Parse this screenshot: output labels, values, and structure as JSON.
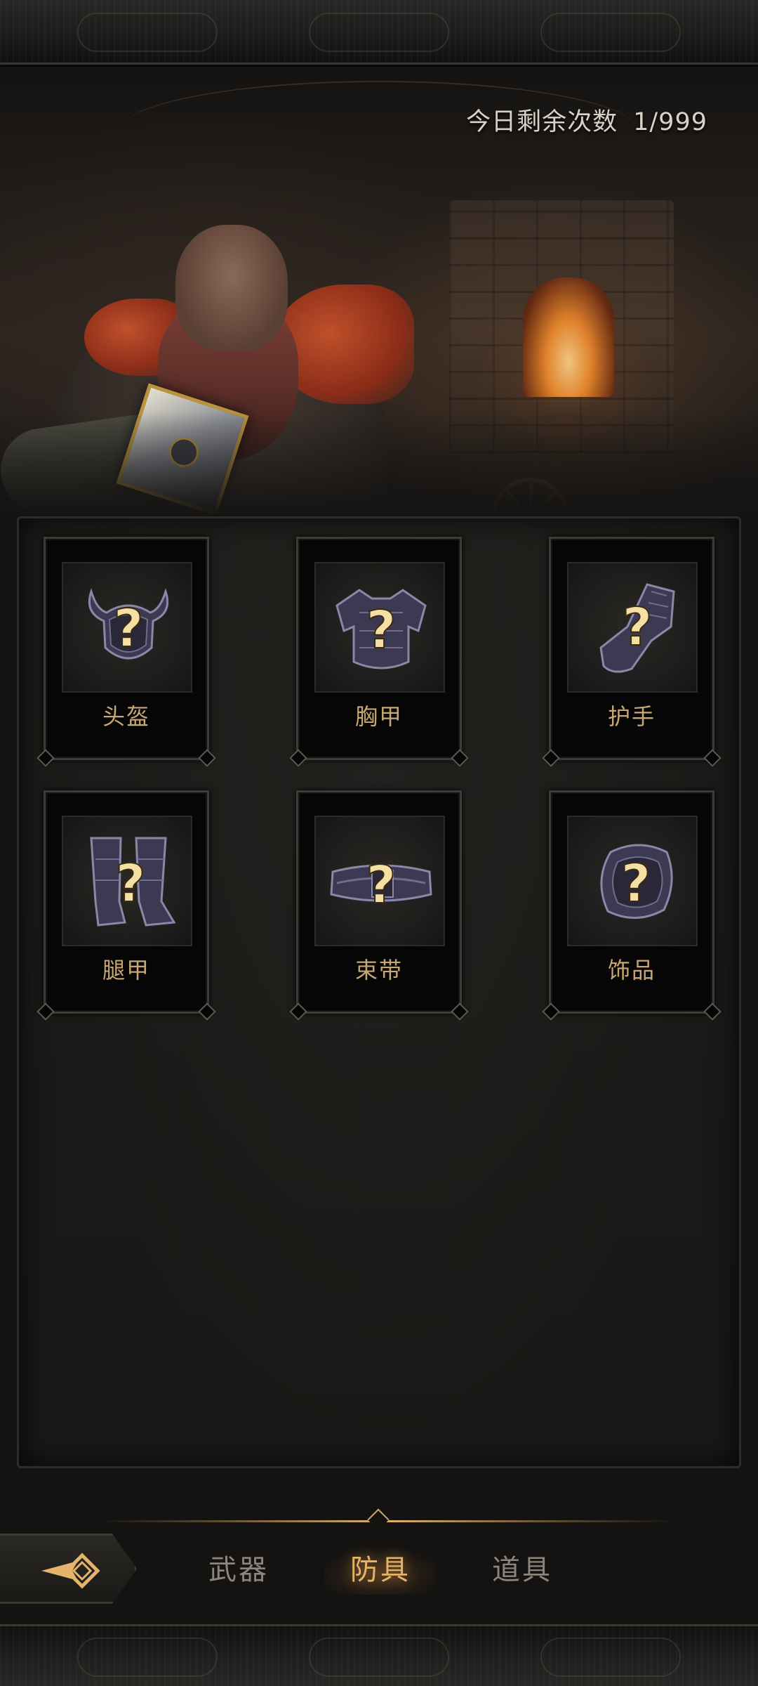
{
  "header": {
    "remaining_label": "今日剩余次数",
    "remaining_count": "1/999"
  },
  "slots": [
    {
      "label": "头盔",
      "icon": "helmet-icon"
    },
    {
      "label": "胸甲",
      "icon": "chest-armor-icon"
    },
    {
      "label": "护手",
      "icon": "gauntlet-icon"
    },
    {
      "label": "腿甲",
      "icon": "leg-armor-icon"
    },
    {
      "label": "束带",
      "icon": "belt-icon"
    },
    {
      "label": "饰品",
      "icon": "trinket-icon"
    }
  ],
  "slot_overlay_glyph": "?",
  "nav": {
    "back_icon": "back-arrow-icon",
    "tabs": [
      {
        "label": "武器",
        "active": false
      },
      {
        "label": "防具",
        "active": true
      },
      {
        "label": "道具",
        "active": false
      }
    ]
  },
  "colors": {
    "accent_gold": "#e4b46a",
    "label_gold": "#c9a772",
    "inactive_tab": "#8b857b",
    "background": "#141312"
  }
}
